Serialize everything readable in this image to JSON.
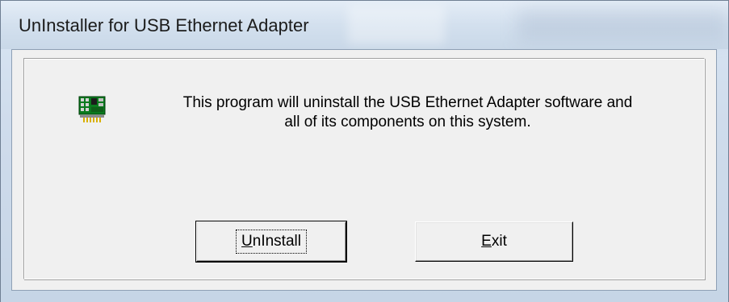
{
  "window": {
    "title": "UnInstaller for USB Ethernet Adapter"
  },
  "content": {
    "icon": "network-card-icon",
    "message_line_1": "This program will uninstall the USB Ethernet Adapter software and",
    "message_line_2": "all of its components on this system."
  },
  "buttons": {
    "uninstall": {
      "mnemonic": "U",
      "rest": "nInstall"
    },
    "exit": {
      "mnemonic": "E",
      "rest": "xit"
    }
  }
}
